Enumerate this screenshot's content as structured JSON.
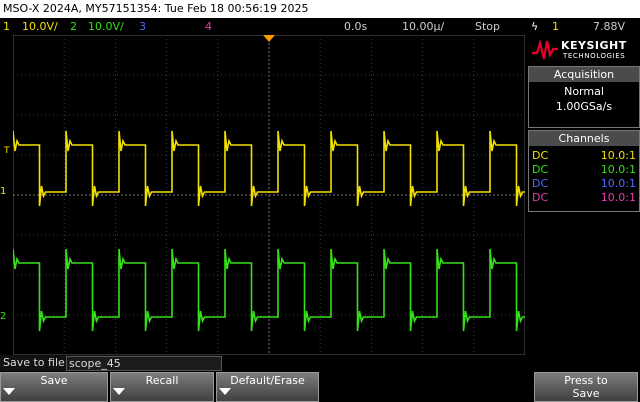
{
  "title": "MSO-X 2024A, MY57151354: Tue Feb 18 00:56:19 2025",
  "status": {
    "ch1_num": "1",
    "ch1_scale": "10.0V/",
    "ch2_num": "2",
    "ch2_scale": "10.0V/",
    "ch3_num": "3",
    "ch4_num": "4",
    "time_delay": "0.0s",
    "timebase": "10.00µ/",
    "run_state": "Stop",
    "trigger_icon": "ϟ",
    "trigger_source": "1",
    "trigger_level": "7.88V"
  },
  "markers": {
    "ch1_level_label": "1",
    "ch2_level_label": "2",
    "trigger_marker": "T"
  },
  "logo": {
    "name": "KEYSIGHT",
    "sub": "TECHNOLOGIES"
  },
  "acquisition": {
    "header": "Acquisition",
    "mode": "Normal",
    "rate": "1.00GSa/s"
  },
  "channels": {
    "header": "Channels",
    "rows": [
      {
        "coupling": "DC",
        "probe": "10.0:1",
        "color": "#f2e000"
      },
      {
        "coupling": "DC",
        "probe": "10.0:1",
        "color": "#36e01a"
      },
      {
        "coupling": "DC",
        "probe": "10.0:1",
        "color": "#4e6bff"
      },
      {
        "coupling": "DC",
        "probe": "10.0:1",
        "color": "#e83cb0"
      }
    ]
  },
  "save_to_file": {
    "label": "Save to file =",
    "value": "scope_45"
  },
  "softkeys": {
    "save": "Save",
    "recall": "Recall",
    "default_erase": "Default/Erase",
    "press_to": "Press to",
    "press_save": "Save"
  },
  "colors": {
    "ch1": "#f2e000",
    "ch2": "#36e01a",
    "ch3": "#4e6bff",
    "ch4": "#e83cb0",
    "trigger": "#ff9900"
  }
}
